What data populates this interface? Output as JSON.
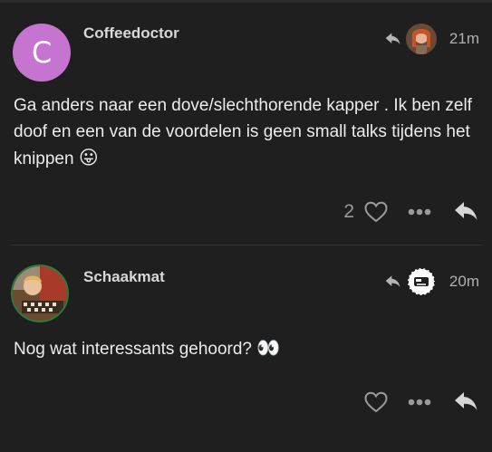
{
  "posts": [
    {
      "avatar_letter": "C",
      "avatar_color": "#c574cf",
      "username": "Coffeedoctor",
      "time": "21m",
      "body": "Ga anders naar een dove/slechthorende kapper . Ik ben zelf doof en een van de voordelen is geen small talks tijdens het knippen",
      "emoji": "😛",
      "like_count": "2"
    },
    {
      "username": "Schaakmat",
      "time": "20m",
      "body": "Nog wat interessants gehoord?",
      "emoji": "👀"
    }
  ],
  "icons": {
    "reply_to": "reply-arrow-icon",
    "like": "heart-icon",
    "more": "more-dots-icon",
    "reply": "reply-icon"
  },
  "colors": {
    "background": "#1f1f1f",
    "text": "#ececec",
    "muted": "#9a9a9a",
    "avatar_ring": "#2b7a3b"
  }
}
